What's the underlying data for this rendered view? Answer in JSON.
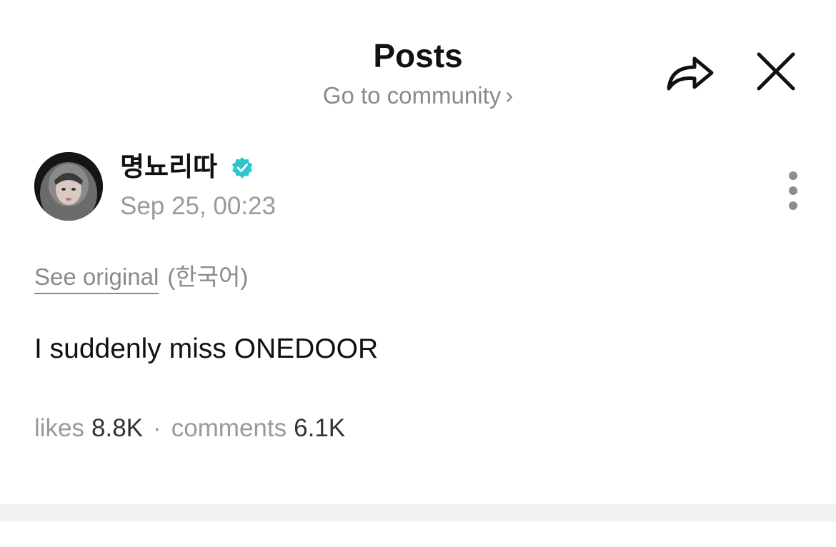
{
  "header": {
    "title": "Posts",
    "community_link": "Go to community",
    "chevron": "›",
    "share_icon": "share-arrow-icon",
    "close_icon": "close-icon"
  },
  "post": {
    "author": {
      "name": "명뇨리따",
      "verified": true,
      "verified_color": "#2cc5d0",
      "avatar_icon": "avatar"
    },
    "time": "Sep 25, 00:23",
    "more_icon": "more-vertical-icon",
    "translation": {
      "see_original": "See original",
      "language": "(한국어)"
    },
    "body": "I suddenly miss ONEDOOR",
    "stats": {
      "likes_label": "likes",
      "likes_value": "8.8K",
      "separator": "·",
      "comments_label": "comments",
      "comments_value": "6.1K"
    }
  }
}
